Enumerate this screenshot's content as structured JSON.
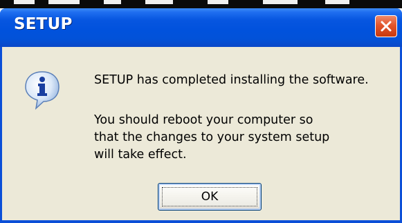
{
  "dialog": {
    "title": "SETUP",
    "icon": "info-icon",
    "message_line1": "SETUP has completed installing the software.",
    "message_line2": "You should reboot your computer so",
    "message_line3": "that the changes to your system setup",
    "message_line4": "will take effect.",
    "ok_label": "OK",
    "close_icon": "close-icon"
  },
  "colors": {
    "titlebar": "#0152dd",
    "client_bg": "#ece9d8",
    "close_button": "#e2552c",
    "button_border": "#003c74"
  }
}
